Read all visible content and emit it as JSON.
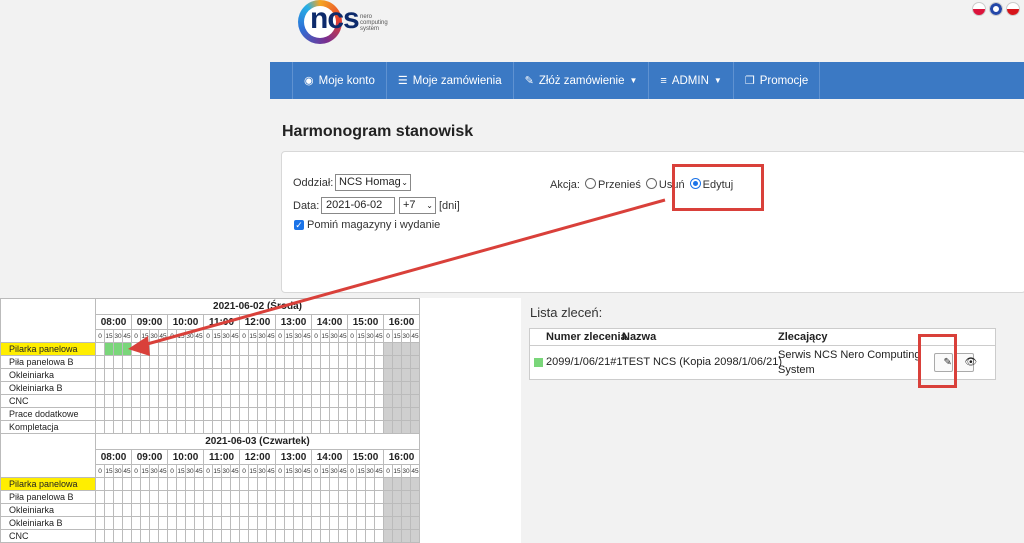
{
  "logo": {
    "text": "ncs",
    "subtitle": "nero computing system"
  },
  "flags": [
    "pl-flag-icon",
    "en-flag-icon",
    "cz-flag-icon"
  ],
  "nav": {
    "items": [
      {
        "label": "Moje konto",
        "icon": "user-icon"
      },
      {
        "label": "Moje zamówienia",
        "icon": "list-icon"
      },
      {
        "label": "Złóż zamówienie",
        "icon": "edit-icon",
        "dropdown": true
      },
      {
        "label": "ADMIN",
        "icon": "sliders-icon",
        "dropdown": true
      },
      {
        "label": "Promocje",
        "icon": "copy-icon"
      }
    ]
  },
  "page_title": "Harmonogram stanowisk",
  "form": {
    "oddzial_label": "Oddział:",
    "oddzial_value": "NCS Homag",
    "data_label": "Data:",
    "data_value": "2021-06-02",
    "range_value": "+7",
    "dni_label": "[dni]",
    "checkbox_label": "Pomiń magazyny i wydanie",
    "akcja_label": "Akcja:",
    "actions": [
      "Przenieś",
      "Usuń",
      "Edytuj"
    ],
    "selected_action": "Edytuj"
  },
  "schedule": {
    "hours": [
      "08:00",
      "09:00",
      "10:00",
      "11:00",
      "12:00",
      "13:00",
      "14:00",
      "15:00",
      "16:00"
    ],
    "quarters": [
      "0",
      "15",
      "30",
      "45"
    ],
    "days": [
      {
        "title": "2021-06-02 (Środa)",
        "rows": [
          "Pilarka panelowa",
          "Piła panelowa B",
          "Okleiniarka",
          "Okleiniarka B",
          "CNC",
          "Prace dodatkowe",
          "Kompletacja"
        ]
      },
      {
        "title": "2021-06-03 (Czwartek)",
        "rows": [
          "Pilarka panelowa",
          "Piła panelowa B",
          "Okleiniarka",
          "Okleiniarka B",
          "CNC"
        ]
      }
    ],
    "highlight_row": "Pilarka panelowa"
  },
  "orders": {
    "title": "Lista zleceń:",
    "headers": [
      "Numer zlecenia",
      "Nazwa",
      "Zlecający"
    ],
    "rows": [
      {
        "numer": "2099/1/06/21#1",
        "nazwa": "TEST NCS (Kopia 2098/1/06/21)",
        "zlecajacy_1": "Serwis NCS Nero Computing",
        "zlecajacy_2": "System",
        "status_color": "#7ad67a"
      }
    ]
  },
  "colors": {
    "nav": "#3b79c4",
    "highlight": "#ffee00",
    "annotation": "#d9403a",
    "green": "#7ad67a"
  }
}
